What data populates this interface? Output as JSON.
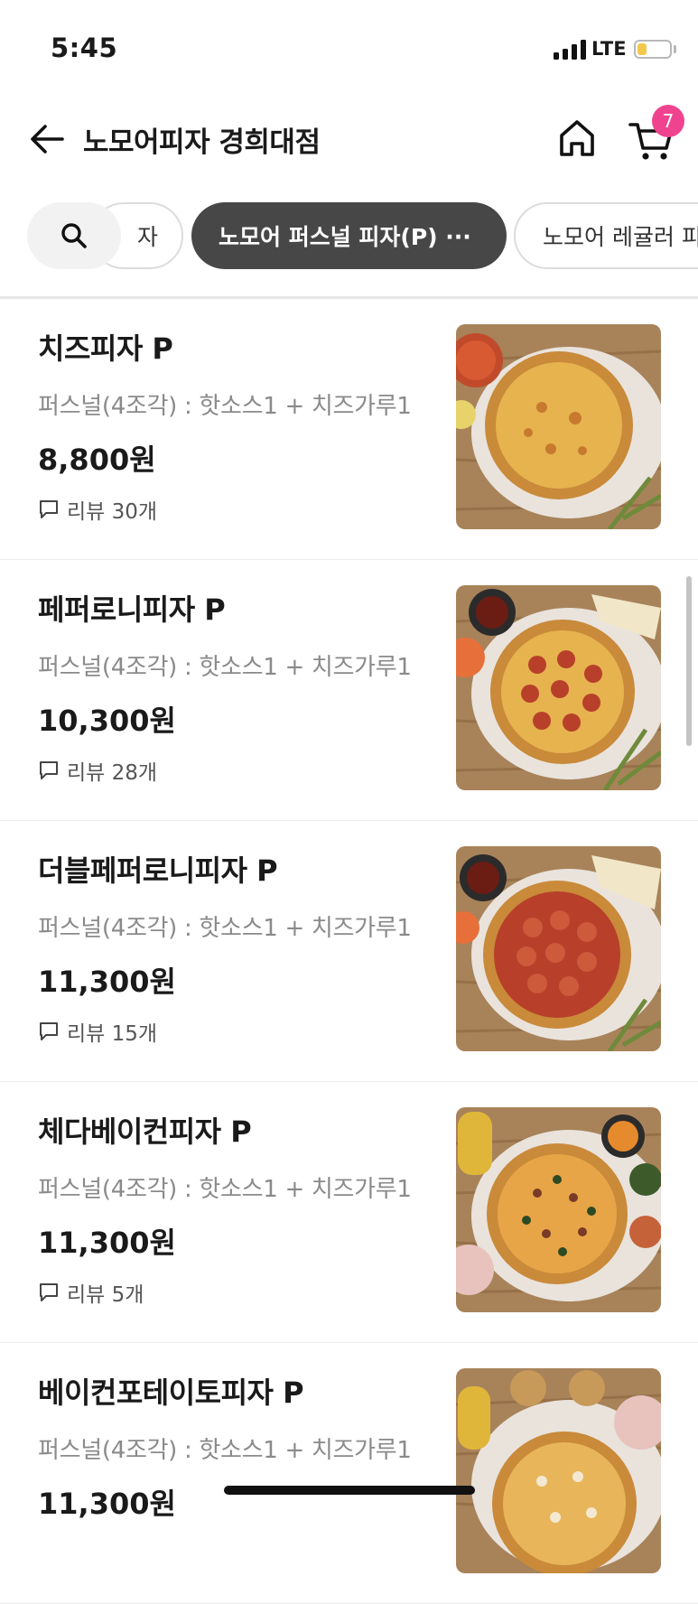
{
  "status_bar": {
    "time": "5:45",
    "network": "LTE",
    "battery_level": 0.3
  },
  "header": {
    "title": "노모어피자 경희대점",
    "back_icon": "arrow-left-icon",
    "home_icon": "home-icon",
    "cart_icon": "cart-icon",
    "cart_count": "7"
  },
  "categories": {
    "search_icon": "search-icon",
    "prev": "자",
    "active": "노모어 퍼스널 피자(P) ···",
    "next": "노모어 레귤러 피"
  },
  "menu": [
    {
      "name": "치즈피자 P",
      "desc": "퍼스널(4조각) : 핫소스1 + 치즈가루1",
      "price": "8,800원",
      "review": "리뷰 30개"
    },
    {
      "name": "페퍼로니피자 P",
      "desc": "퍼스널(4조각) : 핫소스1 + 치즈가루1",
      "price": "10,300원",
      "review": "리뷰 28개"
    },
    {
      "name": "더블페퍼로니피자 P",
      "desc": "퍼스널(4조각) : 핫소스1 + 치즈가루1",
      "price": "11,300원",
      "review": "리뷰 15개"
    },
    {
      "name": "체다베이컨피자 P",
      "desc": "퍼스널(4조각) : 핫소스1 + 치즈가루1",
      "price": "11,300원",
      "review": "리뷰 5개"
    },
    {
      "name": "베이컨포테이토피자 P",
      "desc": "퍼스널(4조각) : 핫소스1 + 치즈가루1",
      "price": "11,300원",
      "review": ""
    }
  ],
  "colors": {
    "badge": "#f0438f",
    "active_chip": "#474747",
    "wood": "#a8835a",
    "crust": "#d99a45"
  }
}
